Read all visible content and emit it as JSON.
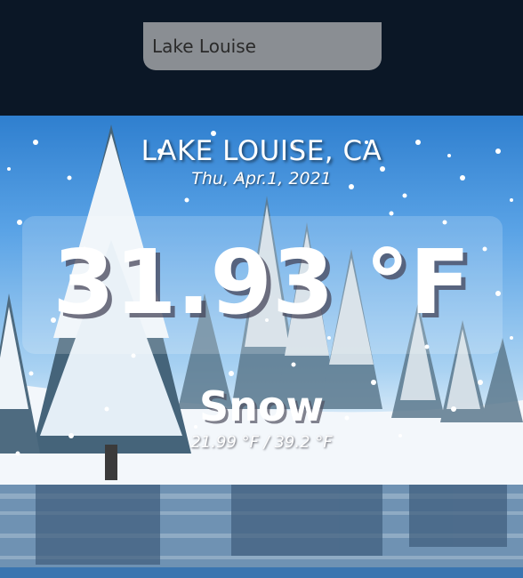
{
  "search": {
    "value": "Lake Louise"
  },
  "weather": {
    "location": "LAKE LOUISE, CA",
    "date": "Thu, Apr.1, 2021",
    "temperature": "31.93 °F",
    "condition": "Snow",
    "range": "21.99 °F / 39.2 °F"
  },
  "background": {
    "scene": "snowy-forest-lake",
    "sky_color": "#3a8ad6",
    "snow_color": "#ffffff"
  }
}
